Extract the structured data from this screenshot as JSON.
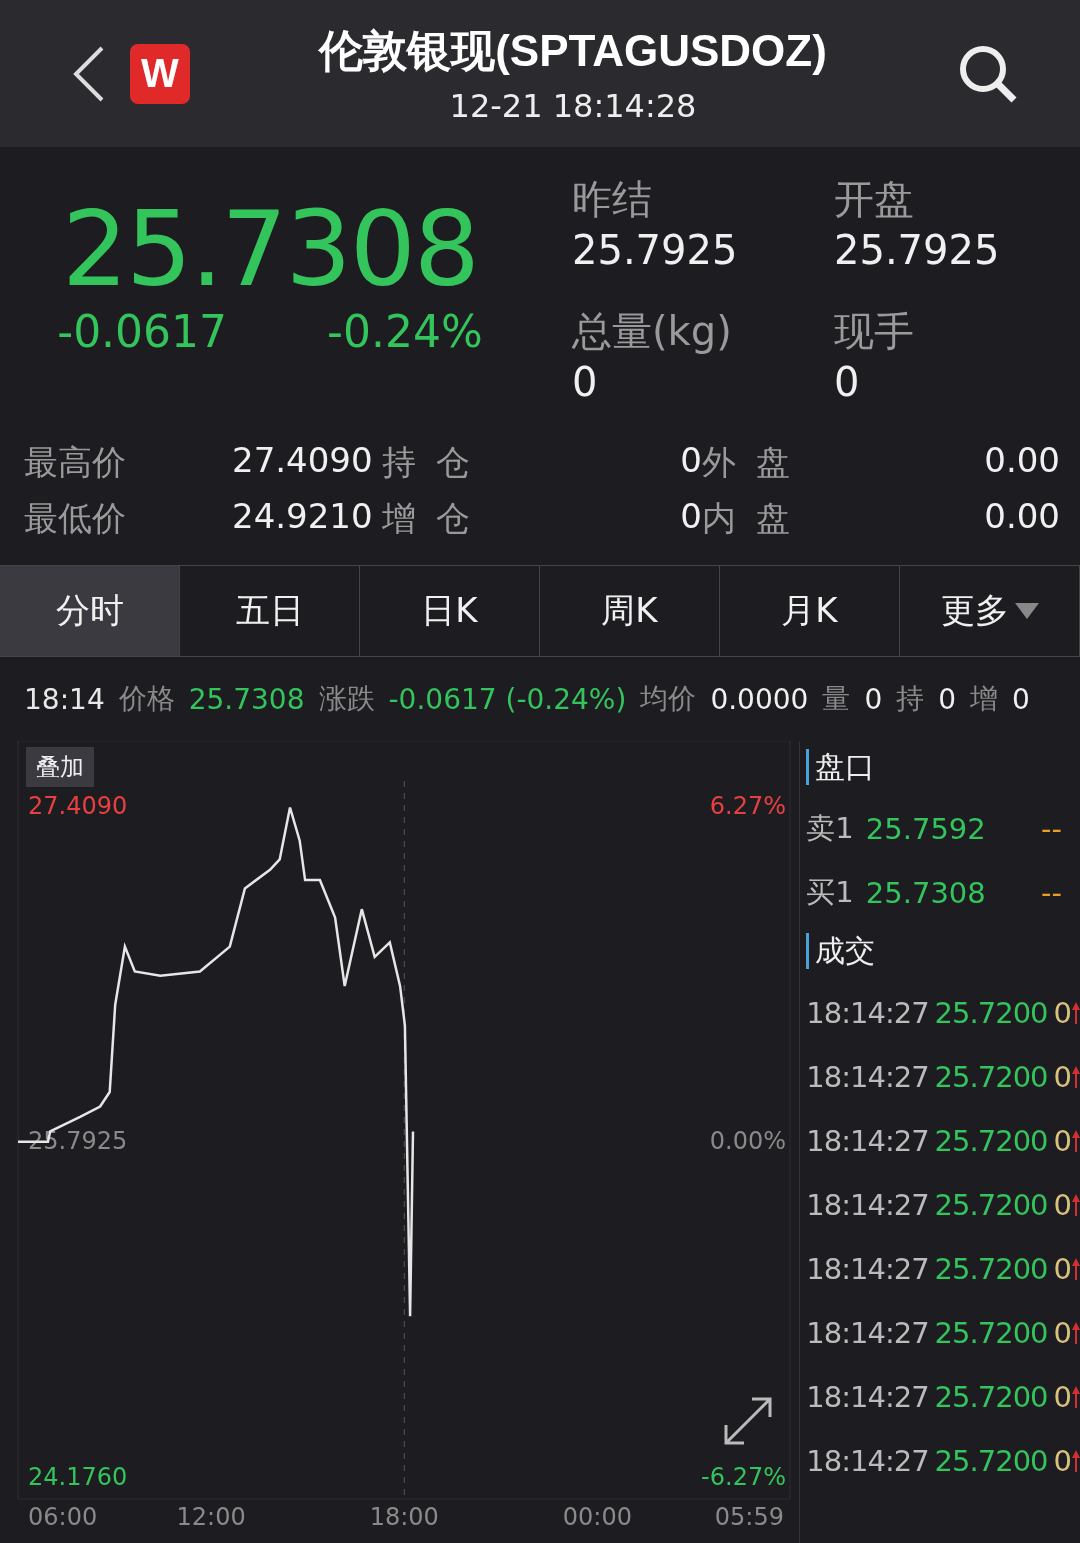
{
  "header": {
    "logo_text": "W",
    "title": "伦敦银现(SPTAGUSDOZ)",
    "time": "12-21 18:14:28"
  },
  "quote": {
    "price": "25.7308",
    "change": "-0.0617",
    "change_pct": "-0.24%",
    "color": "#33c45c",
    "stats": [
      {
        "label": "昨结",
        "value": "25.7925"
      },
      {
        "label": "开盘",
        "value": "25.7925"
      },
      {
        "label": "总量(kg)",
        "value": "0"
      },
      {
        "label": "现手",
        "value": "0"
      }
    ]
  },
  "detail_rows": [
    [
      {
        "label": "最高价",
        "value": "27.4090"
      },
      {
        "label": "持仓",
        "value": "0"
      },
      {
        "label": "外盘",
        "value": "0.00"
      }
    ],
    [
      {
        "label": "最低价",
        "value": "24.9210"
      },
      {
        "label": "增仓",
        "value": "0"
      },
      {
        "label": "内盘",
        "value": "0.00"
      }
    ]
  ],
  "tabs": [
    {
      "label": "分时",
      "selected": true,
      "kind": "tab"
    },
    {
      "label": "五日",
      "selected": false,
      "kind": "tab"
    },
    {
      "label": "日K",
      "selected": false,
      "kind": "tab"
    },
    {
      "label": "周K",
      "selected": false,
      "kind": "tab"
    },
    {
      "label": "月K",
      "selected": false,
      "kind": "tab"
    },
    {
      "label": "更多",
      "selected": false,
      "kind": "dropdown"
    }
  ],
  "info_line": {
    "time": "18:14",
    "fields": [
      {
        "label": "价格",
        "value": "25.7308",
        "color": "#33c45c"
      },
      {
        "label": "涨跌",
        "value": "-0.0617 (-0.24%)",
        "color": "#33c45c"
      },
      {
        "label": "均价",
        "value": "0.0000",
        "color": "#f0f0f0"
      },
      {
        "label": "量",
        "value": "0",
        "color": "#f0f0f0"
      },
      {
        "label": "持",
        "value": "0",
        "color": "#f0f0f0"
      },
      {
        "label": "增",
        "value": "0",
        "color": "#f0f0f0"
      }
    ]
  },
  "chart": {
    "overlay_button": "叠加",
    "end_time_label": "05:59",
    "percent_labels": [
      "6.27%",
      "0.00%",
      "-6.27%"
    ],
    "chart_data": {
      "type": "line",
      "x": [
        6,
        6.93,
        7,
        7.93,
        8.55,
        8.85,
        9.02,
        9.32,
        9.63,
        10.42,
        11.65,
        12.58,
        13.05,
        13.83,
        14.13,
        14.45,
        14.75,
        14.92,
        15.38,
        15.85,
        16.15,
        16.68,
        17.08,
        17.55,
        17.87,
        18.02,
        18.18,
        18.27
      ],
      "series": [
        {
          "color": "#e6e6e6",
          "values": [
            25.79,
            25.79,
            25.84,
            25.91,
            25.96,
            26.03,
            26.45,
            26.73,
            26.61,
            26.59,
            26.61,
            26.73,
            27.01,
            27.1,
            27.15,
            27.4,
            27.24,
            27.05,
            27.05,
            26.87,
            26.54,
            26.91,
            26.68,
            26.75,
            26.54,
            26.35,
            24.95,
            25.84
          ]
        }
      ],
      "xlim": [
        6,
        29.98333
      ],
      "ylim": [
        24.07,
        27.72
      ],
      "ref_lines": [
        {
          "axis": "x",
          "value": 18
        }
      ],
      "xticks": [
        {
          "value": 6,
          "label": "06:00"
        },
        {
          "value": 12,
          "label": "12:00"
        },
        {
          "value": 18,
          "label": "18:00"
        },
        {
          "value": 24,
          "label": "00:00"
        }
      ],
      "yticks": [
        {
          "value": 27.409,
          "label": "27.4090"
        },
        {
          "value": 25.7925,
          "label": "25.7925"
        },
        {
          "value": 24.176,
          "label": "24.1760"
        }
      ]
    }
  },
  "order_book": {
    "title": "盘口",
    "rows": [
      {
        "label": "卖1",
        "price": "25.7592",
        "volume": "--"
      },
      {
        "label": "买1",
        "price": "25.7308",
        "volume": "--"
      }
    ]
  },
  "trades": {
    "title": "成交",
    "rows": [
      {
        "time": "18:14:27",
        "price": "25.7200",
        "volume": "0"
      },
      {
        "time": "18:14:27",
        "price": "25.7200",
        "volume": "0"
      },
      {
        "time": "18:14:27",
        "price": "25.7200",
        "volume": "0"
      },
      {
        "time": "18:14:27",
        "price": "25.7200",
        "volume": "0"
      },
      {
        "time": "18:14:27",
        "price": "25.7200",
        "volume": "0"
      },
      {
        "time": "18:14:27",
        "price": "25.7200",
        "volume": "0"
      },
      {
        "time": "18:14:27",
        "price": "25.7200",
        "volume": "0"
      },
      {
        "time": "18:14:27",
        "price": "25.7200",
        "volume": "0"
      }
    ]
  }
}
